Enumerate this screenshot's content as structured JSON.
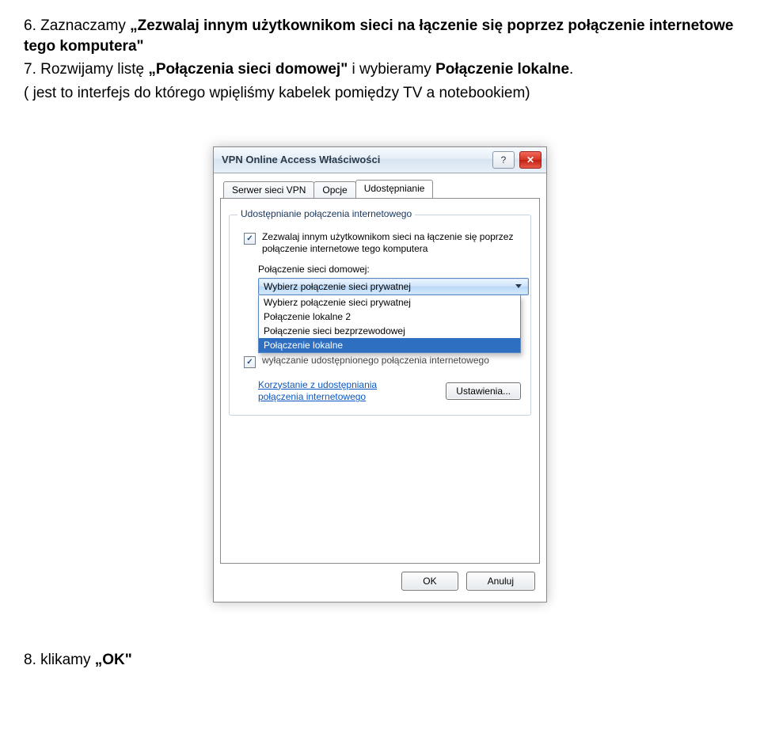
{
  "instructions": {
    "step6_prefix": "6. Zaznaczamy ",
    "step6_quote": "„Zezwalaj innym użytkownikom sieci na łączenie się poprzez połączenie internetowe tego komputera\"",
    "step7_prefix": "7. Rozwijamy listę ",
    "step7_quote": "„Połączenia sieci domowej\"",
    "step7_mid": " i wybieramy ",
    "step7_bold": "Połączenie lokalne",
    "step7_tail": ".",
    "step7_note": "( jest to interfejs do którego wpięliśmy kabelek pomiędzy TV a notebookiem)",
    "step8_prefix": "8. klikamy ",
    "step8_quote": "„OK\""
  },
  "dialog": {
    "title": "VPN Online Access Właściwości",
    "tabs": {
      "vpn": "Serwer sieci VPN",
      "opcje": "Opcje",
      "udost": "Udostępnianie"
    },
    "group_legend": "Udostępnianie połączenia internetowego",
    "allow_label": "Zezwalaj innym użytkownikom sieci na łączenie się poprzez połączenie internetowe tego komputera",
    "home_label": "Połączenie sieci domowej:",
    "combo_value": "Wybierz połączenie sieci prywatnej",
    "dropdown": {
      "opt0": "Wybierz połączenie sieci prywatnej",
      "opt1": "Połączenie lokalne 2",
      "opt2": "Połączenie sieci bezprzewodowej",
      "opt3": "Połączenie lokalne"
    },
    "covered_tail": "wyłączanie udostępnionego połączenia internetowego",
    "link_text": "Korzystanie z udostępniania połączenia internetowego",
    "settings_btn": "Ustawienia...",
    "ok": "OK",
    "cancel": "Anuluj"
  }
}
